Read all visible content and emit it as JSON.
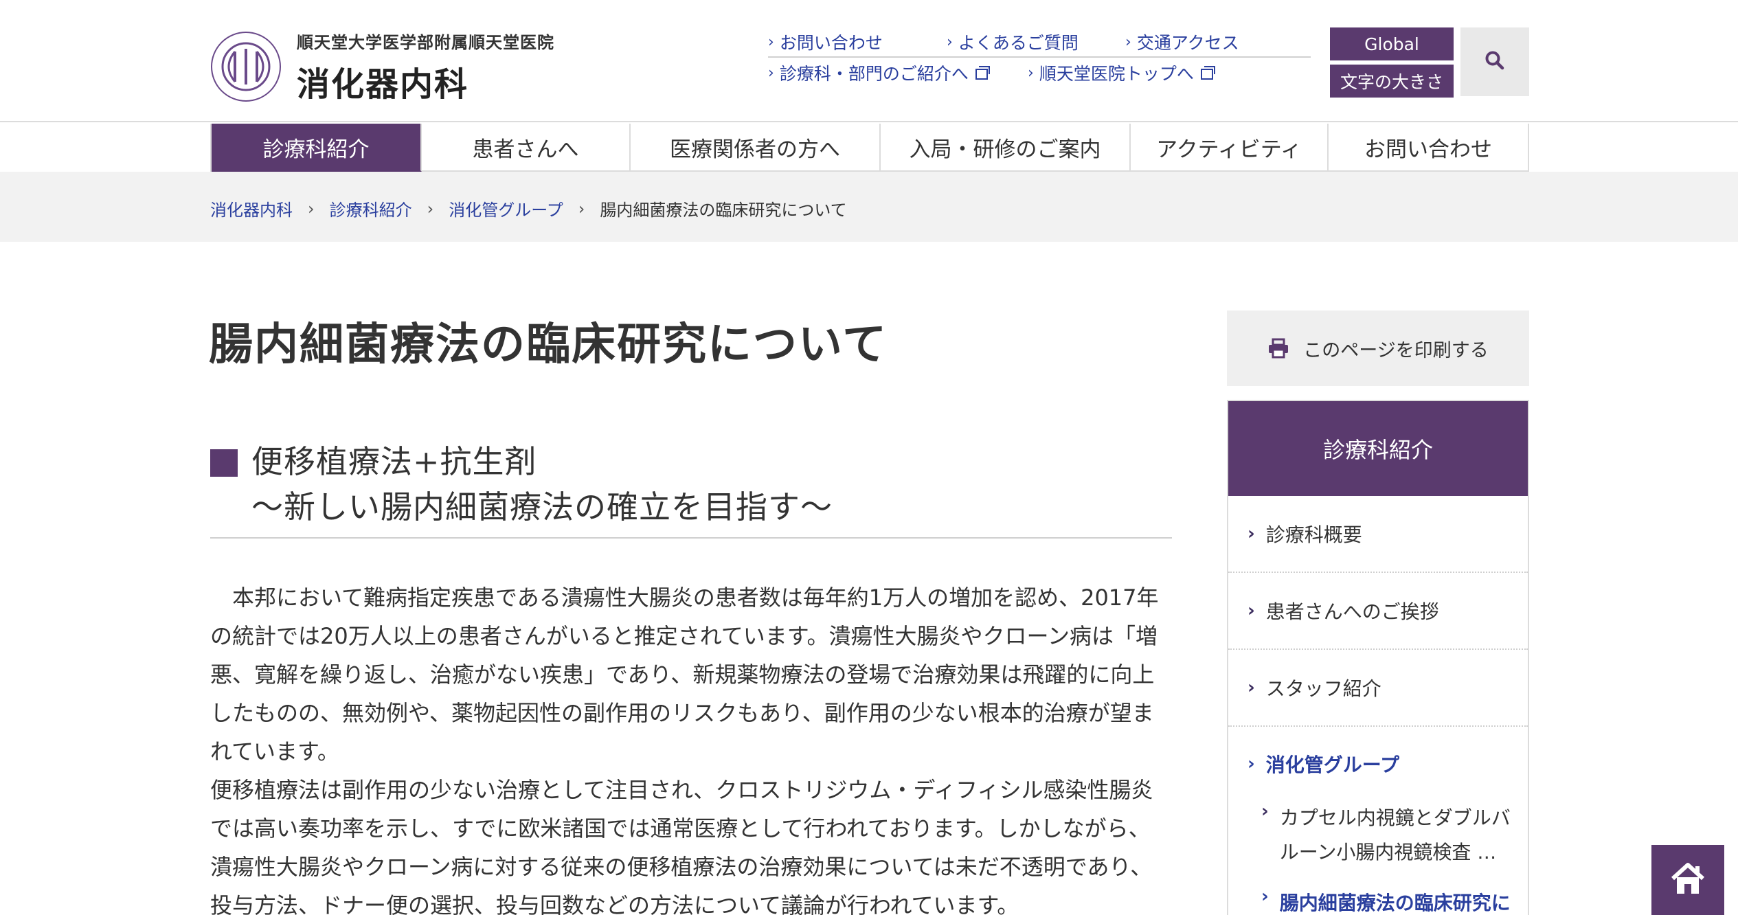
{
  "header": {
    "logo_sub": "順天堂大学医学部附属順天堂医院",
    "logo_main": "消化器内科",
    "util_links_row1": [
      "お問い合わせ",
      "よくあるご質問",
      "交通アクセス"
    ],
    "util_links_row2": [
      "診療科・部門のご紹介へ",
      "順天堂医院トップへ"
    ],
    "global_label": "Global",
    "font_size_label": "文字の大きさ"
  },
  "nav": {
    "items": [
      "診療科紹介",
      "患者さんへ",
      "医療関係者の方へ",
      "入局・研修のご案内",
      "アクティビティ",
      "お問い合わせ"
    ],
    "active_index": 0
  },
  "breadcrumb": {
    "items": [
      "消化器内科",
      "診療科紹介",
      "消化管グループ"
    ],
    "current": "腸内細菌療法の臨床研究について",
    "separator": "›"
  },
  "main": {
    "title": "腸内細菌療法の臨床研究について",
    "section_line1": "便移植療法+抗生剤",
    "section_line2": "～新しい腸内細菌療法の確立を目指す～",
    "paragraph1": "本邦において難病指定疾患である潰瘍性大腸炎の患者数は毎年約1万人の増加を認め、2017年の統計では20万人以上の患者さんがいると推定されています。潰瘍性大腸炎やクローン病は「増悪、寛解を繰り返し、治癒がない疾患」であり、新規薬物療法の登場で治療効果は飛躍的に向上したものの、無効例や、薬物起因性の副作用のリスクもあり、副作用の少ない根本的治療が望まれています。",
    "paragraph2": "便移植療法は副作用の少ない治療として注目され、クロストリジウム・ディフィシル感染性腸炎では高い奏功率を示し、すでに欧米諸国では通常医療として行われております。しかしながら、潰瘍性大腸炎やクローン病に対する従来の便移植療法の治療効果については未だ不透明であり、投与方法、ドナー便の選択、投与回数などの方法について議論が行われています。"
  },
  "sidebar": {
    "print_label": "このページを印刷する",
    "heading": "診療科紹介",
    "items": [
      "診療科概要",
      "患者さんへのご挨拶",
      "スタッフ紹介",
      "消化管グループ"
    ],
    "sub_items": [
      "カプセル内視鏡とダブルバルーン小腸内視鏡検査 …",
      "腸内細菌療法の臨床研究に"
    ]
  },
  "colors": {
    "brand_purple": "#5a3a6e",
    "link_blue": "#2a3f9e",
    "breadcrumb_bg": "#f2f2f2"
  },
  "icons": {
    "search": "search-icon",
    "print": "printer-icon",
    "home": "home-icon",
    "external": "external-window-icon",
    "chevron": "chevron-right-icon"
  }
}
